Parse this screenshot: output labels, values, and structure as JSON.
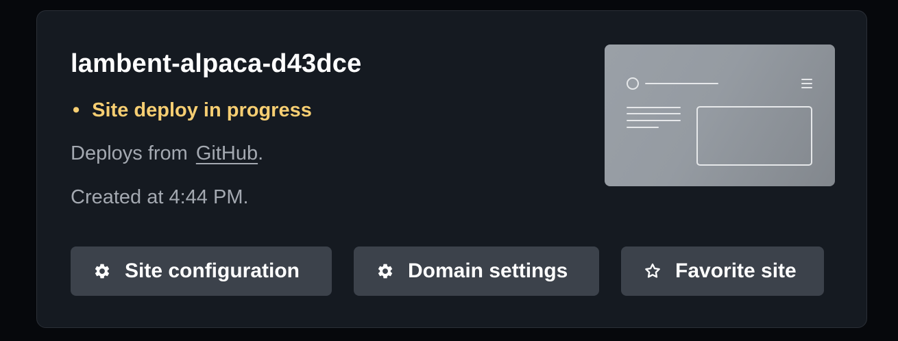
{
  "site": {
    "name": "lambent-alpaca-d43dce",
    "status_bullet": "•",
    "status": "Site deploy in progress",
    "status_color": "#f6ce72",
    "deploys_prefix": "Deploys from",
    "deploys_source": "GitHub",
    "deploys_suffix": ".",
    "created": "Created at 4:44 PM."
  },
  "preview": {
    "icon": "website-wireframe-thumbnail"
  },
  "actions": {
    "site_configuration": {
      "label": "Site configuration",
      "icon": "gear-icon"
    },
    "domain_settings": {
      "label": "Domain settings",
      "icon": "gear-icon"
    },
    "favorite_site": {
      "label": "Favorite site",
      "icon": "star-outline-icon"
    }
  }
}
